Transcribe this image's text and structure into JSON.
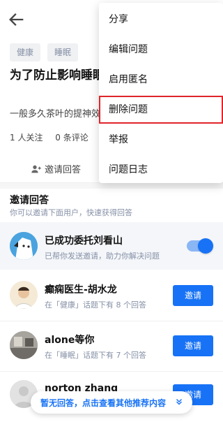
{
  "header": {
    "back_icon": "arrow-left-icon"
  },
  "tags": [
    "健康",
    "睡眠"
  ],
  "question": {
    "title": "为了防止影响睡眠，该喝什么茶?",
    "excerpt": "一般多久茶叶的提神效果会消失？",
    "followers": "1 人关注",
    "comments": "0 条评论"
  },
  "actions": {
    "invite_answer": "邀请回答"
  },
  "invite": {
    "title": "邀请回答",
    "subtitle": "你可以邀请下面用户，快速获得回答",
    "delegate_name": "已成功委托刘看山",
    "delegate_sub": "已帮你发送邀请，助力你解决问题",
    "delegate_enabled": true
  },
  "users": [
    {
      "name": "癫痫医生-胡水龙",
      "sub": "在「健康」话题下有 8 个回答",
      "button": "邀请"
    },
    {
      "name": "alone等你",
      "sub": "在「睡眠」话题下有 7 个回答",
      "button": "邀请"
    },
    {
      "name": "norton zhang",
      "sub": "",
      "button": "邀请"
    }
  ],
  "float_bar": "暂无回答，点击查看其他推荐内容",
  "menu": {
    "items": [
      "分享",
      "编辑问题",
      "启用匿名",
      "删除问题",
      "举报",
      "问题日志"
    ],
    "highlighted": "删除问题"
  },
  "colors": {
    "accent": "#1772f6",
    "highlight": "#e0252a"
  }
}
